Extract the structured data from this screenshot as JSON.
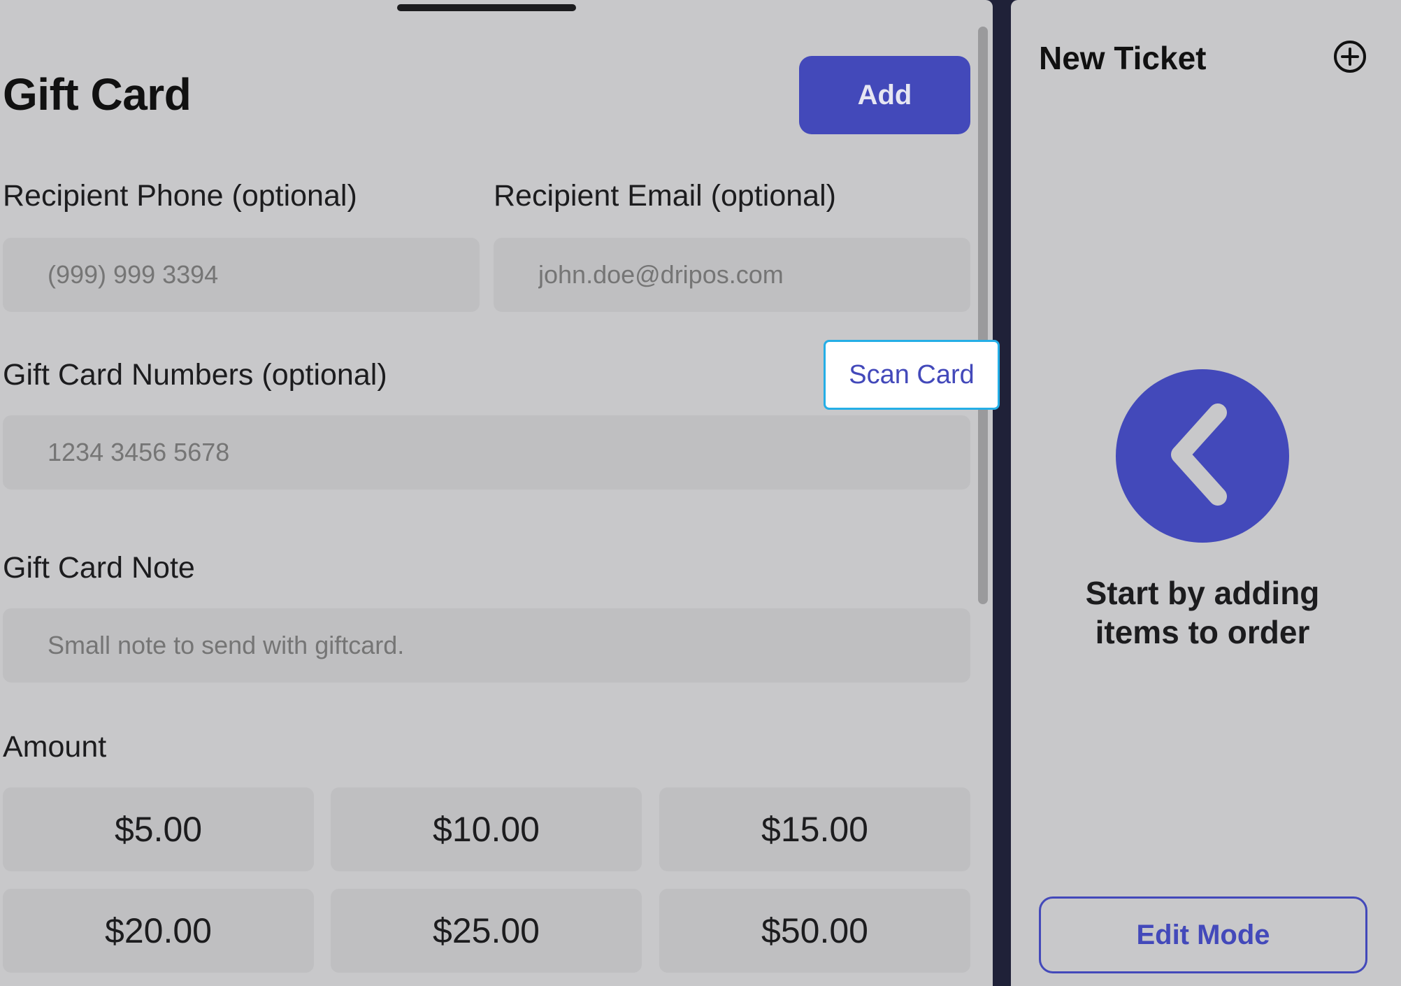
{
  "gift_card": {
    "title": "Gift Card",
    "add_label": "Add",
    "phone": {
      "label": "Recipient Phone (optional)",
      "placeholder": "(999) 999 3394",
      "value": ""
    },
    "email": {
      "label": "Recipient Email (optional)",
      "placeholder": "john.doe@dripos.com",
      "value": ""
    },
    "numbers": {
      "label": "Gift Card Numbers (optional)",
      "placeholder": "1234 3456 5678",
      "value": "",
      "scan_label": "Scan Card"
    },
    "note": {
      "label": "Gift Card Note",
      "placeholder": "Small note to send with giftcard.",
      "value": ""
    },
    "amount": {
      "label": "Amount",
      "options": [
        "$5.00",
        "$10.00",
        "$15.00",
        "$20.00",
        "$25.00",
        "$50.00"
      ]
    }
  },
  "ticket": {
    "title": "New Ticket",
    "add_icon": "plus-circle-icon",
    "back_icon": "chevron-left-icon",
    "empty_line1": "Start by adding",
    "empty_line2": "items to order",
    "edit_mode_label": "Edit Mode"
  },
  "colors": {
    "accent": "#4349BA",
    "panel_bg": "#C8C8CA",
    "input_bg": "#BFBFC1",
    "divider": "#1F2138",
    "focus_ring": "#25AEE6"
  }
}
